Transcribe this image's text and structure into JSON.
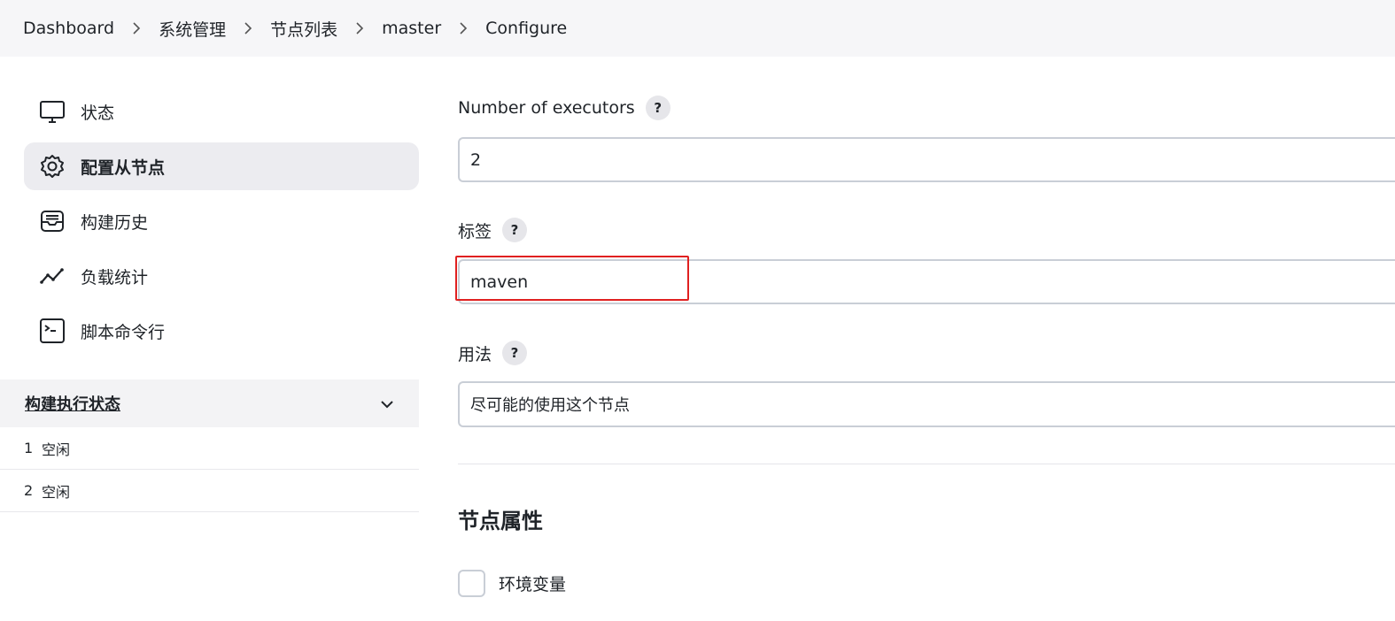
{
  "breadcrumb": [
    "Dashboard",
    "系统管理",
    "节点列表",
    "master",
    "Configure"
  ],
  "sidebar": {
    "items": [
      {
        "label": "状态",
        "icon": "monitor-icon",
        "active": false
      },
      {
        "label": "配置从节点",
        "icon": "gear-icon",
        "active": true
      },
      {
        "label": "构建历史",
        "icon": "inbox-icon",
        "active": false
      },
      {
        "label": "负载统计",
        "icon": "line-chart-icon",
        "active": false
      },
      {
        "label": "脚本命令行",
        "icon": "terminal-icon",
        "active": false
      }
    ],
    "executors_title": "构建执行状态",
    "executors": [
      {
        "num": "1",
        "status": "空闲"
      },
      {
        "num": "2",
        "status": "空闲"
      }
    ]
  },
  "form": {
    "executors_label": "Number of executors",
    "executors_value": "2",
    "labels_label": "标签",
    "labels_value": "maven",
    "usage_label": "用法",
    "usage_value": "尽可能的使用这个节点",
    "help": "?",
    "section_title": "节点属性",
    "env_vars_label": "环境变量"
  },
  "colors": {
    "highlight": "#e02020",
    "active_bg": "#ececf0",
    "breadcrumb_bg": "#f6f6f8"
  }
}
